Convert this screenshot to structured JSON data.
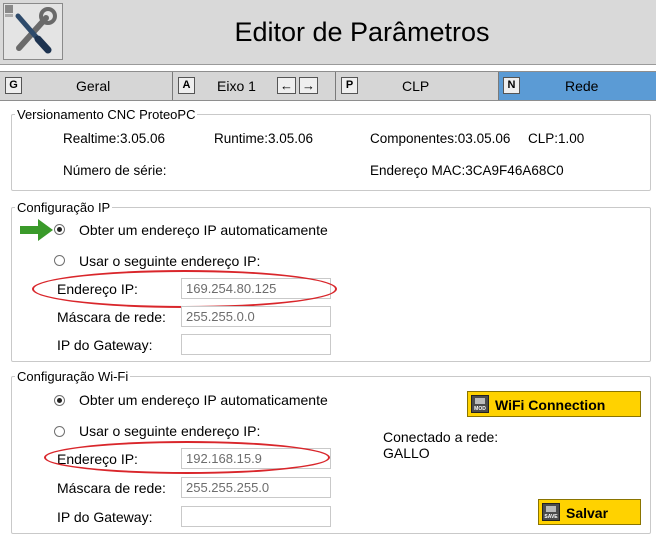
{
  "header": {
    "title": "Editor de Parâmetros",
    "logo_icon": "tools-wrench-screwdriver-icon"
  },
  "tabs": [
    {
      "key": "G",
      "label": "Geral"
    },
    {
      "key": "A",
      "label": "Eixo 1"
    },
    {
      "key": "P",
      "label": "CLP"
    },
    {
      "key": "N",
      "label": "Rede",
      "active": true,
      "color": "#5b9bd5"
    }
  ],
  "versioning": {
    "legend": "Versionamento CNC ProteoPC",
    "realtime": "Realtime:3.05.06",
    "runtime": "Runtime:3.05.06",
    "components": "Componentes:03.05.06",
    "clp": "CLP:1.00",
    "serial_label": "Número de série:",
    "mac": "Endereço MAC:3CA9F46A68C0"
  },
  "ip_config": {
    "legend": "Configuração IP",
    "auto_option": "Obter um endereço IP automaticamente",
    "manual_option": "Usar o seguinte endereço IP:",
    "ip_label": "Endereço IP:",
    "ip_value": "169.254.80.125",
    "mask_label": "Máscara de rede:",
    "mask_value": "255.255.0.0",
    "gateway_label": "IP do Gateway:",
    "gateway_value": ""
  },
  "wifi_config": {
    "legend": "Configuração Wi-Fi",
    "auto_option": "Obter um endereço IP automaticamente",
    "manual_option": "Usar o seguinte endereço IP:",
    "ip_label": "Endereço IP:",
    "ip_value": "192.168.15.9",
    "mask_label": "Máscara de rede:",
    "mask_value": "255.255.255.0",
    "gateway_label": "IP do Gateway:",
    "gateway_value": "",
    "connected_label": "Conectado a rede:",
    "network_name": "GALLO",
    "wifi_button": "WiFi Connection",
    "wifi_button_icon_text": "MOD",
    "save_button": "Salvar",
    "save_button_icon_text": "SAVE"
  },
  "colors": {
    "highlight_oval": "#d9262b",
    "arrow": "#3a9a2a",
    "button_yellow": "#ffd200"
  }
}
